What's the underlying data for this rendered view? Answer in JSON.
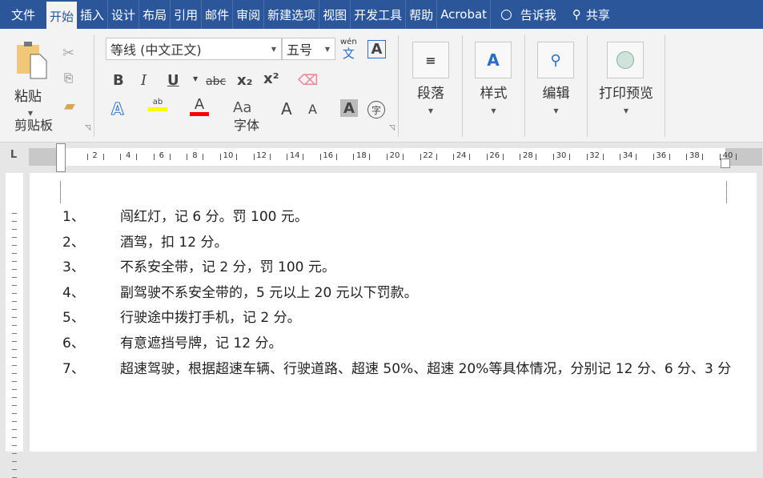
{
  "tabs": [
    "文件",
    "开始",
    "插入",
    "设计",
    "布局",
    "引用",
    "邮件",
    "审阅",
    "新建选项",
    "视图",
    "开发工具",
    "帮助",
    "Acrobat"
  ],
  "active_tab": "开始",
  "tell_me": "告诉我",
  "share": "共享",
  "clipboard": {
    "paste": "粘贴",
    "label": "剪贴板"
  },
  "font": {
    "name": "等线 (中文正文)",
    "size": "五号",
    "label": "字体",
    "phonetic": "wén",
    "phonetic_char": "文",
    "bold": "B",
    "italic": "I",
    "underline": "U",
    "strike": "abc",
    "sub": "x₂",
    "sup": "x²",
    "case": "Aa",
    "grow": "A",
    "shrink": "A",
    "shade": "A",
    "enclose": "字"
  },
  "groups": {
    "paragraph": "段落",
    "styles": "样式",
    "editing": "编辑",
    "print_preview": "打印预览"
  },
  "ruler": {
    "numbers": [
      2,
      4,
      6,
      8,
      10,
      12,
      14,
      16,
      18,
      20,
      22,
      24,
      26,
      28,
      30,
      32,
      34,
      36,
      38,
      40
    ]
  },
  "document": {
    "items": [
      {
        "num": "1、",
        "text": "闯红灯，记 6 分。罚 100 元。"
      },
      {
        "num": "2、",
        "text": "酒驾，扣 12 分。"
      },
      {
        "num": "3、",
        "text": "不系安全带，记 2 分，罚 100 元。"
      },
      {
        "num": "4、",
        "text": "副驾驶不系安全带的，5 元以上 20 元以下罚款。"
      },
      {
        "num": "5、",
        "text": "行驶途中拨打手机，记 2 分。"
      },
      {
        "num": "6、",
        "text": "有意遮挡号牌，记 12 分。"
      },
      {
        "num": "7、",
        "text": "超速驾驶，根据超速车辆、行驶道路、超速 50%、超速 20%等具体情况，分别记 12 分、6 分、3 分"
      }
    ]
  },
  "colors": {
    "accent": "#2b579a",
    "highlight": "#ffff00",
    "font_color": "#ff0000"
  }
}
